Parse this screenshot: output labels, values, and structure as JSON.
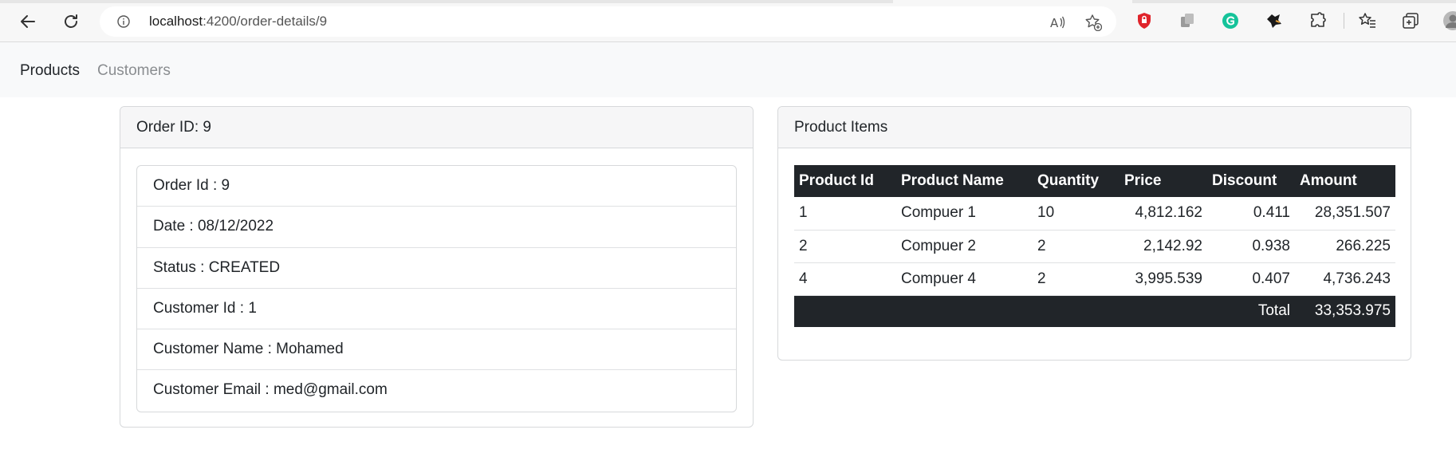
{
  "browser": {
    "url_host": "localhost",
    "url_path": ":4200/order-details/9",
    "icons": [
      "back-arrow-icon",
      "reload-icon",
      "info-icon",
      "read-aloud-icon",
      "add-favorite-icon",
      "shield-extension-icon",
      "copy-extension-icon",
      "grammarly-icon",
      "puzzle-extension-icon",
      "extensions-icon",
      "favorites-icon",
      "collections-icon",
      "profile-avatar-icon"
    ]
  },
  "nav": {
    "products": "Products",
    "customers": "Customers"
  },
  "order_card": {
    "header": "Order ID: 9",
    "items": [
      "Order Id : 9",
      "Date : 08/12/2022",
      "Status : CREATED",
      "Customer Id : 1",
      "Customer Name : Mohamed",
      "Customer Email : med@gmail.com"
    ]
  },
  "items_card": {
    "header": "Product Items",
    "columns": [
      "Product Id",
      "Product Name",
      "Quantity",
      "Price",
      "Discount",
      "Amount"
    ],
    "rows": [
      {
        "id": "1",
        "name": "Compuer 1",
        "qty": "10",
        "price": "4,812.162",
        "discount": "0.411",
        "amount": "28,351.507"
      },
      {
        "id": "2",
        "name": "Compuer 2",
        "qty": "2",
        "price": "2,142.92",
        "discount": "0.938",
        "amount": "266.225"
      },
      {
        "id": "4",
        "name": "Compuer 4",
        "qty": "2",
        "price": "3,995.539",
        "discount": "0.407",
        "amount": "4,736.243"
      }
    ],
    "total_label": "Total",
    "total_value": "33,353.975"
  },
  "colors": {
    "table_dark": "#212529",
    "navbar_bg": "#f8f9fa",
    "muted_link": "#8a8d90"
  }
}
